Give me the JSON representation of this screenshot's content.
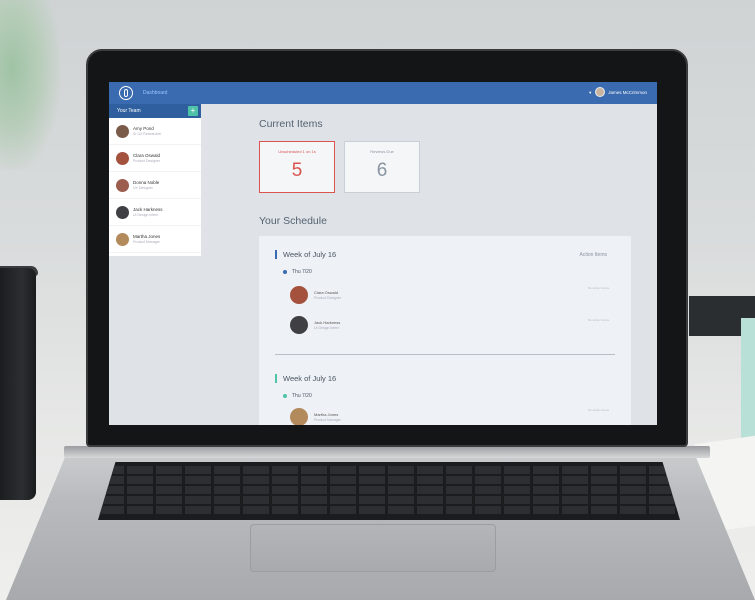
{
  "header": {
    "nav_dashboard": "Dashboard",
    "user_name": "James McCrimmon"
  },
  "sidebar": {
    "title": "Your Team",
    "add_label": "+",
    "members": [
      {
        "name": "Amy Pond",
        "role": "Sr UX Researcher",
        "color": "#7a5b4a"
      },
      {
        "name": "Clara Oswald",
        "role": "Product Designer",
        "color": "#a4523e"
      },
      {
        "name": "Donna Noble",
        "role": "UX Designer",
        "color": "#9c5d4e"
      },
      {
        "name": "Jack Harkness",
        "role": "UI Design Intern",
        "color": "#3f3f44"
      },
      {
        "name": "Martha Jones",
        "role": "Product Manager",
        "color": "#b38a5c"
      }
    ]
  },
  "current_items": {
    "title": "Current Items",
    "cards": [
      {
        "label": "Unscheduled 1 on 1s",
        "value": "5",
        "alert": true
      },
      {
        "label": "Reviews Due",
        "value": "6",
        "alert": false
      }
    ]
  },
  "schedule": {
    "title": "Your Schedule",
    "action_items_label": "Action Items",
    "weeks": [
      {
        "label": "Week of July 16",
        "day": "Thu 7/20",
        "entries": [
          {
            "name": "Clara Oswald",
            "role": "Product Designer",
            "action": "No Action Items"
          },
          {
            "name": "Jack Harkness",
            "role": "UI Design Intern",
            "action": "No Action Items"
          }
        ]
      },
      {
        "label": "Week of July 16",
        "day": "Thu 7/20",
        "entries": [
          {
            "name": "Martha Jones",
            "role": "Product Manager",
            "action": "No Action Items"
          }
        ]
      }
    ]
  },
  "colors": {
    "header_blue": "#3a6ab0",
    "accent_teal": "#4fc3a8",
    "alert_red": "#d9534f"
  }
}
